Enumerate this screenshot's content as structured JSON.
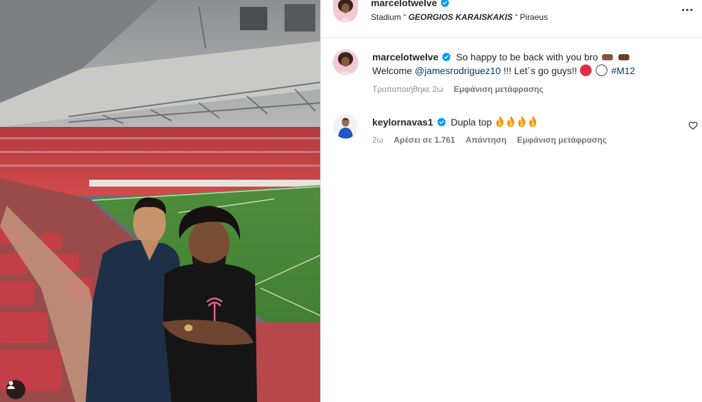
{
  "post": {
    "author": "marcelotwelve",
    "location_prefix": "Stadium “",
    "location_name": "GEORGIOS KARAISKAKIS",
    "location_suffix": "“ Piraeus"
  },
  "caption": {
    "author": "marcelotwelve",
    "line1_text": "So happy to be back with you bro",
    "line2_prefix": "Welcome",
    "mention": "@jamesrodriguez10",
    "line2_suffix": "!!! Let´s go guys!!",
    "hashtag": "#M12",
    "edited_label": "Τροποποιήθηκε",
    "time": "2ω",
    "see_translation": "Εμφάνιση μετάφρασης"
  },
  "comments": [
    {
      "author": "keylornavas1",
      "text": "Dupla top",
      "time": "2ω",
      "likes_label": "Αρέσει σε 1.761",
      "reply_label": "Απάντηση",
      "see_translation": "Εμφάνιση μετάφρασης"
    }
  ],
  "icons": {
    "verified": "verified-badge-icon",
    "more": "more-options-icon",
    "heart": "heart-outline-icon",
    "tagged_user": "user-tag-icon",
    "fist": "fist-bump-emoji",
    "fire": "fire-emoji",
    "red_circle": "red-circle-emoji",
    "white_circle": "white-circle-emoji"
  },
  "colors": {
    "verified_blue": "#0095f6",
    "link": "#00376b",
    "secondary_text": "#8e8e8e",
    "emoji_red": "#dd2e44"
  }
}
